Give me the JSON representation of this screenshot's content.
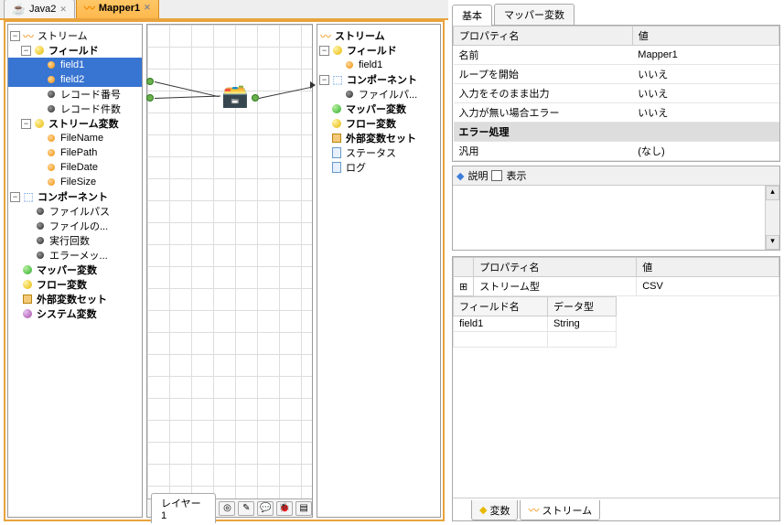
{
  "tabs": {
    "java": {
      "label": "Java2"
    },
    "mapper": {
      "label": "Mapper1"
    }
  },
  "leftTree": {
    "stream": "ストリーム",
    "field": "フィールド",
    "field1": "field1",
    "field2": "field2",
    "recNo": "レコード番号",
    "recCount": "レコード件数",
    "streamVar": "ストリーム変数",
    "fileName": "FileName",
    "filePath": "FilePath",
    "fileDate": "FileDate",
    "fileSize": "FileSize",
    "component": "コンポーネント",
    "filePathJa": "ファイルパス",
    "fileNo": "ファイルの...",
    "execCount": "実行回数",
    "errorMsg": "エラーメッ...",
    "mapperVar": "マッパー変数",
    "flowVar": "フロー変数",
    "externalVarSet": "外部変数セット",
    "systemVar": "システム変数"
  },
  "rightTree": {
    "stream": "ストリーム",
    "field": "フィールド",
    "field1": "field1",
    "component": "コンポーネント",
    "filePathJa": "ファイルパ...",
    "mapperVar": "マッパー変数",
    "flowVar": "フロー変数",
    "externalVarSet": "外部変数セット",
    "status": "ステータス",
    "log": "ログ"
  },
  "canvas": {
    "layerTab": "レイヤー1"
  },
  "propTabs": {
    "basic": "基本",
    "mapperVar": "マッパー変数"
  },
  "propHeader": {
    "name": "プロパティ名",
    "value": "値"
  },
  "props": {
    "name": {
      "k": "名前",
      "v": "Mapper1"
    },
    "loopStart": {
      "k": "ループを開始",
      "v": "いいえ"
    },
    "passThrough": {
      "k": "入力をそのまま出力",
      "v": "いいえ"
    },
    "noInputErr": {
      "k": "入力が無い場合エラー",
      "v": "いいえ"
    },
    "errorHandling": {
      "k": "エラー処理",
      "v": ""
    },
    "general": {
      "k": "汎用",
      "v": "(なし)"
    }
  },
  "desc": {
    "title": "説明",
    "showLabel": "表示"
  },
  "lowerHeader": {
    "name": "プロパティ名",
    "value": "値"
  },
  "lowerRows": {
    "streamType": {
      "k": "ストリーム型",
      "v": "CSV"
    }
  },
  "fieldTable": {
    "h1": "フィールド名",
    "h2": "データ型",
    "r1c1": "field1",
    "r1c2": "String"
  },
  "bottomTabs": {
    "vars": "変数",
    "stream": "ストリーム"
  }
}
